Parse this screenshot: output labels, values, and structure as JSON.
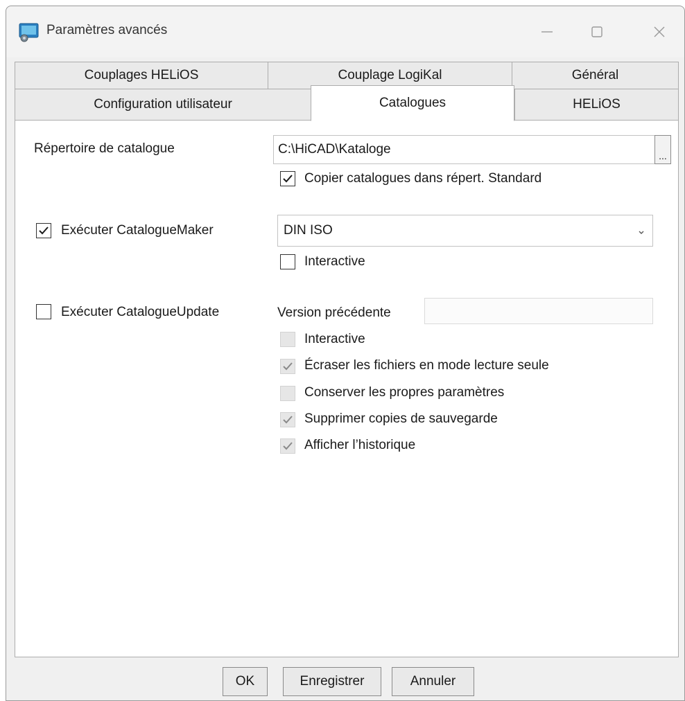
{
  "window": {
    "title": "Paramètres avancés",
    "icon": "app-icon",
    "controls": {
      "minimize": "minimize-icon",
      "maximize": "maximize-icon",
      "close": "close-icon"
    }
  },
  "tabs": {
    "row1": [
      {
        "label": "Couplages HELiOS"
      },
      {
        "label": "Couplage LogiKal"
      },
      {
        "label": "Général"
      }
    ],
    "row2": [
      {
        "label": "Configuration utilisateur"
      },
      {
        "label": "Catalogues",
        "active": true
      },
      {
        "label": "HELiOS"
      }
    ]
  },
  "catalog": {
    "dir_label": "Répertoire de catalogue",
    "dir_value": "C:\\HiCAD\\Kataloge",
    "browse_label": "...",
    "copy_label": "Copier catalogues dans répert. Standard",
    "copy_checked": true
  },
  "maker": {
    "label": "Exécuter CatalogueMaker",
    "checked": true,
    "selected": "DIN ISO",
    "interactive_label": "Interactive",
    "interactive_checked": false
  },
  "update": {
    "label": "Exécuter CatalogueUpdate",
    "checked": false,
    "prev_version_label": "Version précédente",
    "prev_version_value": "",
    "options": [
      {
        "label": "Interactive",
        "checked": false
      },
      {
        "label": "Écraser les fichiers en mode lecture seule",
        "checked": true
      },
      {
        "label": "Conserver les propres paramètres",
        "checked": false
      },
      {
        "label": "Supprimer copies de sauvegarde",
        "checked": true
      },
      {
        "label": "Afficher l’historique",
        "checked": true
      }
    ]
  },
  "buttons": {
    "ok": "OK",
    "save": "Enregistrer",
    "cancel": "Annuler"
  }
}
